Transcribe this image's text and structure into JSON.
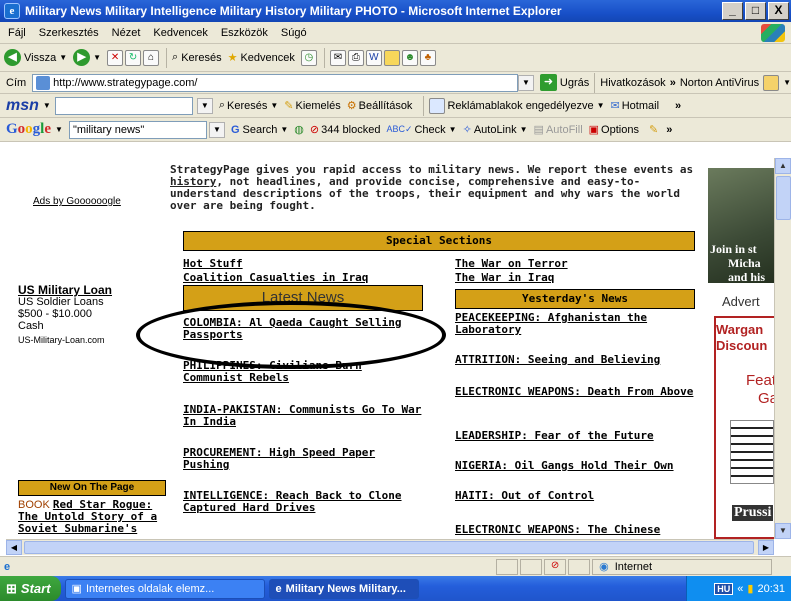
{
  "window": {
    "title": "Military News Military Intelligence Military History Military PHOTO - Microsoft Internet Explorer",
    "btn_min": "_",
    "btn_max": "□",
    "btn_close": "X"
  },
  "menu": [
    "Fájl",
    "Szerkesztés",
    "Nézet",
    "Kedvencek",
    "Eszközök",
    "Súgó"
  ],
  "toolbar": {
    "back": "Vissza",
    "search": "Keresés",
    "favorites": "Kedvencek"
  },
  "address": {
    "label": "Cím",
    "url": "http://www.strategypage.com/",
    "go": "Ugrás",
    "links": "Hivatkozások",
    "norton": "Norton AntiVirus"
  },
  "msn": {
    "logo": "msn",
    "search": "Keresés",
    "highlight": "Kiemelés",
    "settings": "Beállítások",
    "popup": "Reklámablakok engedélyezve",
    "hotmail": "Hotmail"
  },
  "google": {
    "query": "\"military news\"",
    "search": "Search",
    "blocked": "344 blocked",
    "check": "Check",
    "autolink": "AutoLink",
    "autofill": "AutoFill",
    "options": "Options"
  },
  "page": {
    "ads": "Ads by Goooooogle",
    "loan": {
      "title": "US Military Loan",
      "line1": "US Soldier Loans",
      "line2": "$500 - $10.000",
      "line3": "Cash",
      "site": "US-Military-Loan.com"
    },
    "new_on_page": "New On The Page",
    "book_prefix": "BOOK",
    "book_title": "Red Star Rogue: The Untold Story of a Soviet Submarine's",
    "intro_before": "StrategyPage gives you rapid access to military news. We report these events as ",
    "intro_link": "history",
    "intro_after": ", not headlines, and provide concise, comprehensive and easy-to-understand descriptions of the troops, their equipment and why wars the world over are being fought.",
    "special_sections": "Special Sections",
    "latest_news": "Latest News",
    "yesterdays_news": "Yesterday's News",
    "left_links": [
      "Hot Stuff",
      "Coalition Casualties in Iraq",
      "COLOMBIA: Al Qaeda Caught Selling Passports",
      "PHILIPPINES: Civilians Burn Communist Rebels",
      "INDIA-PAKISTAN: Communists Go To War In India",
      "PROCUREMENT: High Speed Paper Pushing",
      "INTELLIGENCE: Reach Back to Clone Captured Hard Drives"
    ],
    "right_links": [
      "The War on Terror",
      "The War in Iraq",
      "PEACEKEEPING: Afghanistan the Laboratory",
      "ATTRITION: Seeing and Believing",
      "ELECTRONIC WEAPONS: Death From Above",
      "LEADERSHIP: Fear of the Future",
      "NIGERIA: Oil Gangs Hold Their Own",
      "HAITI: Out of Control",
      "ELECTRONIC WEAPONS: The Chinese"
    ],
    "banner": {
      "join1": "Join in st",
      "join2": "Micha",
      "join3": "and his",
      "advert": "Advert",
      "war1": "Wargan",
      "war2": "Discoun",
      "feat1": "Feat",
      "feat2": "Ga",
      "prussia": "Prussi"
    }
  },
  "status": {
    "zone": "Internet"
  },
  "taskbar": {
    "start": "Start",
    "task1": "Internetes oldalak elemz...",
    "task2": "Military News Military...",
    "lang": "HU",
    "time": "20:31"
  }
}
